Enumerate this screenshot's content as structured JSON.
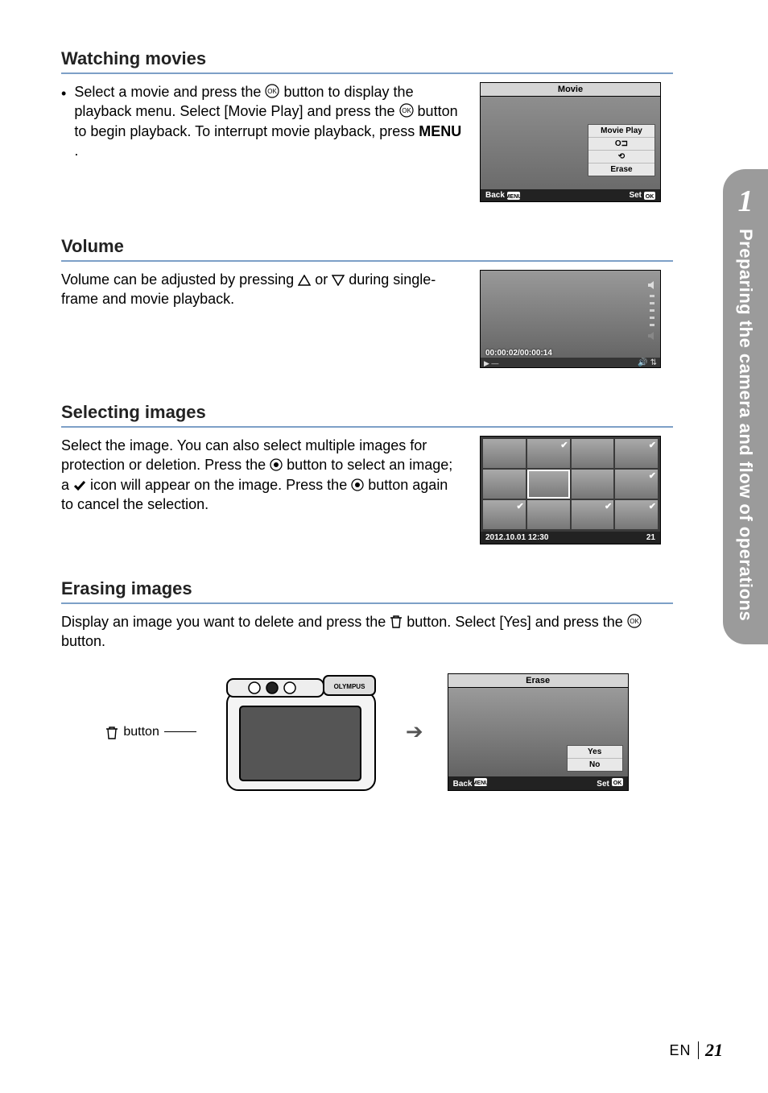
{
  "sidebar": {
    "chapter": "1",
    "title": "Preparing the camera and flow of operations"
  },
  "sections": {
    "watching": {
      "heading": "Watching movies",
      "bullet_a": "Select a movie and press the ",
      "bullet_b": " button to display the playback menu. Select [Movie Play] and press the ",
      "bullet_c": " button to begin playback. To interrupt movie playback, press ",
      "bullet_d": ".",
      "menu_word": "MENU"
    },
    "volume": {
      "heading": "Volume",
      "text_a": "Volume can be adjusted by pressing ",
      "text_b": " or ",
      "text_c": " during single-frame and movie playback."
    },
    "selecting": {
      "heading": "Selecting images",
      "text_a": "Select the image. You can also select multiple images for protection or deletion. Press the ",
      "text_b": " button to select an image; a ",
      "text_c": " icon will appear on the image. Press the ",
      "text_d": " button again to cancel the selection."
    },
    "erasing": {
      "heading": "Erasing images",
      "text_a": "Display an image you want to delete and press the ",
      "text_b": " button. Select [Yes] and press the ",
      "text_c": " button."
    }
  },
  "fig1": {
    "title": "Movie",
    "menu": [
      "Movie Play",
      "O⊐",
      "⟲",
      "Erase"
    ],
    "back": "Back",
    "set": "Set"
  },
  "fig2": {
    "timecode": "00:00:02/00:00:14"
  },
  "fig3": {
    "date": "2012.10.01 12:30",
    "count": "21"
  },
  "fig4": {
    "title": "Erase",
    "opts": [
      "Yes",
      "No"
    ],
    "back": "Back",
    "set": "Set"
  },
  "camera_label": " button",
  "footer": {
    "lang": "EN",
    "page": "21"
  }
}
